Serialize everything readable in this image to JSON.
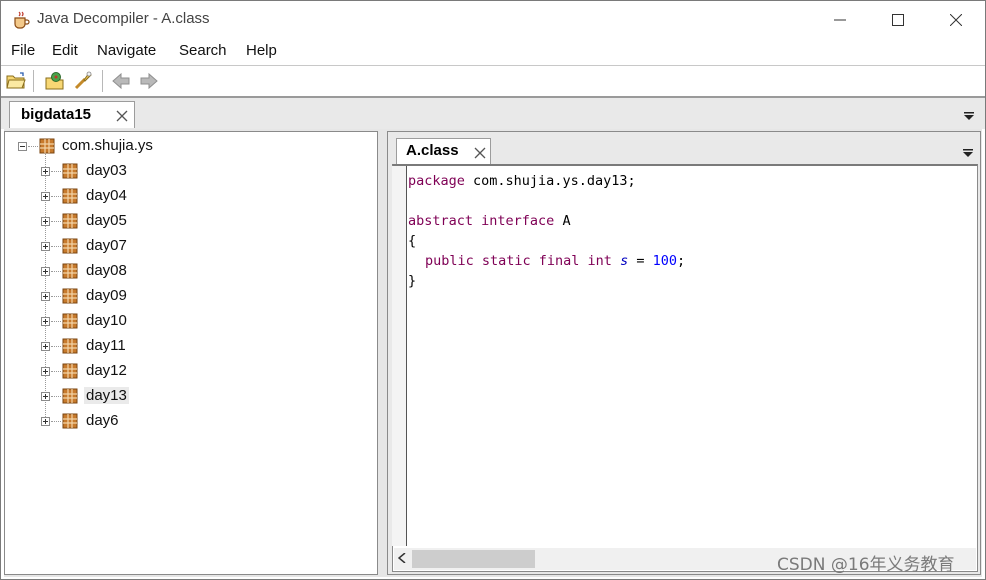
{
  "window": {
    "title": "Java Decompiler - A.class"
  },
  "menu": [
    "File",
    "Edit",
    "Navigate",
    "Search",
    "Help"
  ],
  "toolbar": {
    "icons": [
      "open-file-icon",
      "open-type-icon",
      "search-icon",
      "back-arrow-icon",
      "forward-arrow-icon"
    ]
  },
  "outer_tab": {
    "label": "bigdata15"
  },
  "tree": {
    "root": "com.shujia.ys",
    "children": [
      "day03",
      "day04",
      "day05",
      "day07",
      "day08",
      "day09",
      "day10",
      "day11",
      "day12",
      "day13",
      "day6"
    ],
    "selected": "day13"
  },
  "code_tab": {
    "label": "A.class"
  },
  "code": {
    "line1_kw": "package",
    "line1_rest": " com.shujia.ys.day13;",
    "line3_kw": "abstract interface",
    "line3_rest": " A",
    "line4": "{",
    "line5_kw": "public static final int",
    "line5_field": "s",
    "line5_eq": " = ",
    "line5_num": "100",
    "line5_end": ";",
    "line6": "}"
  },
  "watermark": "CSDN @16年义务教育",
  "colors": {
    "keyword": "#7f0055",
    "field": "#0000c0",
    "number": "#0000ff",
    "package_icon": "#b5651d"
  }
}
